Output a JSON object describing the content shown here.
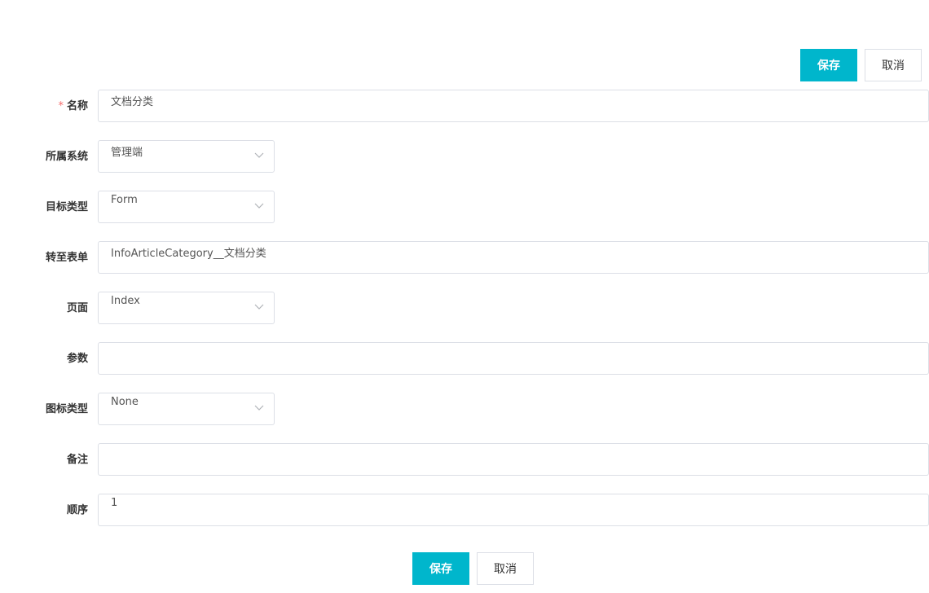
{
  "toolbar": {
    "save_label": "保存",
    "cancel_label": "取消"
  },
  "form": {
    "name": {
      "label": "名称",
      "required_mark": "*",
      "value": "文档分类"
    },
    "system": {
      "label": "所属系统",
      "value": "管理端",
      "icon": "chevron-down-icon"
    },
    "target_type": {
      "label": "目标类型",
      "value": "Form",
      "icon": "chevron-down-icon"
    },
    "goto_form": {
      "label": "转至表单",
      "value": "InfoArticleCategory__文档分类"
    },
    "page": {
      "label": "页面",
      "value": "Index",
      "icon": "chevron-down-icon"
    },
    "params": {
      "label": "参数",
      "value": ""
    },
    "icon_type": {
      "label": "图标类型",
      "value": "None",
      "icon": "chevron-down-icon"
    },
    "remark": {
      "label": "备注",
      "value": ""
    },
    "order": {
      "label": "顺序",
      "value": "1"
    }
  },
  "footer": {
    "save_label": "保存",
    "cancel_label": "取消"
  },
  "colors": {
    "primary": "#00b6cc",
    "border": "#dcdfe6",
    "required": "#f56c6c"
  }
}
